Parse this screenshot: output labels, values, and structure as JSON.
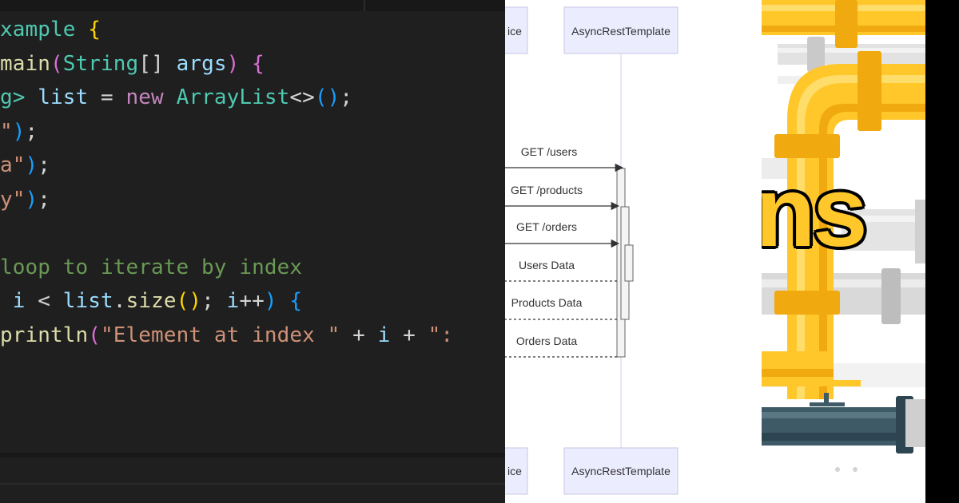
{
  "code_editor": {
    "lines": [
      [
        {
          "t": "xample ",
          "c": "#4ec9b0"
        },
        {
          "t": "{",
          "c": "#ffd700"
        }
      ],
      [
        {
          "t": "main",
          "c": "#dcdcaa"
        },
        {
          "t": "(",
          "c": "#da70d6"
        },
        {
          "t": "String",
          "c": "#4ec9b0"
        },
        {
          "t": "[] ",
          "c": "#d4d4d4"
        },
        {
          "t": "args",
          "c": "#9cdcfe"
        },
        {
          "t": ") ",
          "c": "#da70d6"
        },
        {
          "t": "{",
          "c": "#da70d6"
        }
      ],
      [
        {
          "t": "g> ",
          "c": "#4ec9b0"
        },
        {
          "t": "list",
          "c": "#9cdcfe"
        },
        {
          "t": " = ",
          "c": "#d4d4d4"
        },
        {
          "t": "new ",
          "c": "#c586c0"
        },
        {
          "t": "ArrayList",
          "c": "#4ec9b0"
        },
        {
          "t": "<>",
          "c": "#d4d4d4"
        },
        {
          "t": "()",
          "c": "#179fff"
        },
        {
          "t": ";",
          "c": "#d4d4d4"
        }
      ],
      [
        {
          "t": "\"",
          "c": "#ce9178"
        },
        {
          "t": ")",
          "c": "#179fff"
        },
        {
          "t": ";",
          "c": "#d4d4d4"
        }
      ],
      [
        {
          "t": "a\"",
          "c": "#ce9178"
        },
        {
          "t": ")",
          "c": "#179fff"
        },
        {
          "t": ";",
          "c": "#d4d4d4"
        }
      ],
      [
        {
          "t": "y\"",
          "c": "#ce9178"
        },
        {
          "t": ")",
          "c": "#179fff"
        },
        {
          "t": ";",
          "c": "#d4d4d4"
        }
      ],
      [],
      [
        {
          "t": "loop to iterate by index",
          "c": "#6a9955"
        }
      ],
      [
        {
          "t": " i ",
          "c": "#9cdcfe"
        },
        {
          "t": "< ",
          "c": "#d4d4d4"
        },
        {
          "t": "list",
          "c": "#9cdcfe"
        },
        {
          "t": ".",
          "c": "#d4d4d4"
        },
        {
          "t": "size",
          "c": "#dcdcaa"
        },
        {
          "t": "()",
          "c": "#ffd700"
        },
        {
          "t": "; ",
          "c": "#d4d4d4"
        },
        {
          "t": "i",
          "c": "#9cdcfe"
        },
        {
          "t": "++",
          "c": "#d4d4d4"
        },
        {
          "t": ") ",
          "c": "#179fff"
        },
        {
          "t": "{",
          "c": "#179fff"
        }
      ],
      [
        {
          "t": "println",
          "c": "#dcdcaa"
        },
        {
          "t": "(",
          "c": "#da70d6"
        },
        {
          "t": "\"Element at index \"",
          "c": "#ce9178"
        },
        {
          "t": " + ",
          "c": "#d4d4d4"
        },
        {
          "t": "i",
          "c": "#9cdcfe"
        },
        {
          "t": " + ",
          "c": "#d4d4d4"
        },
        {
          "t": "\":",
          "c": "#ce9178"
        }
      ]
    ]
  },
  "sequence_diagram": {
    "participant_partial_label": "ice",
    "participant_label": "AsyncRestTemplate",
    "messages": [
      {
        "label": "GET /users",
        "style": "solid"
      },
      {
        "label": "GET /products",
        "style": "solid"
      },
      {
        "label": "GET /orders",
        "style": "solid"
      },
      {
        "label": "Users Data",
        "style": "dashed"
      },
      {
        "label": "Products Data",
        "style": "dashed"
      },
      {
        "label": "Orders Data",
        "style": "dashed"
      }
    ],
    "colors": {
      "actor_fill": "#ececff",
      "actor_stroke": "#c6c6e6",
      "lifeline": "#d6cfe6",
      "arrow": "#333333"
    }
  },
  "illustration": {
    "visible_text": "ns",
    "pipe_colors": {
      "yellow": "#ffc72a",
      "yellow_dark": "#f0a90e",
      "gray": "#d9d9d9",
      "teal": "#3d5a66"
    }
  }
}
